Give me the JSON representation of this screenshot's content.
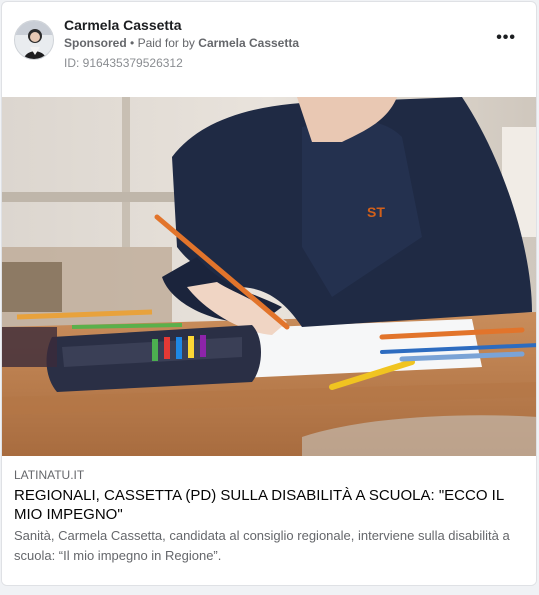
{
  "post": {
    "author": "Carmela Cassetta",
    "sponsored_label": "Sponsored",
    "separator": "•",
    "paid_for_prefix": "Paid for by",
    "paid_for_name": "Carmela Cassetta",
    "id_text": "ID: 916435379526312",
    "more_icon": "more-options-icon"
  },
  "link_preview": {
    "domain": "LATINATU.IT",
    "headline": "REGIONALI, CASSETTA (PD) SULLA DISABILITÀ A SCUOLA: \"ECCO IL MIO IMPEGNO\"",
    "description": "Sanità, Carmela Cassetta, candidata al consiglio regionale, interviene sulla disabilità a scuola: “Il mio impegno in Regione”."
  }
}
